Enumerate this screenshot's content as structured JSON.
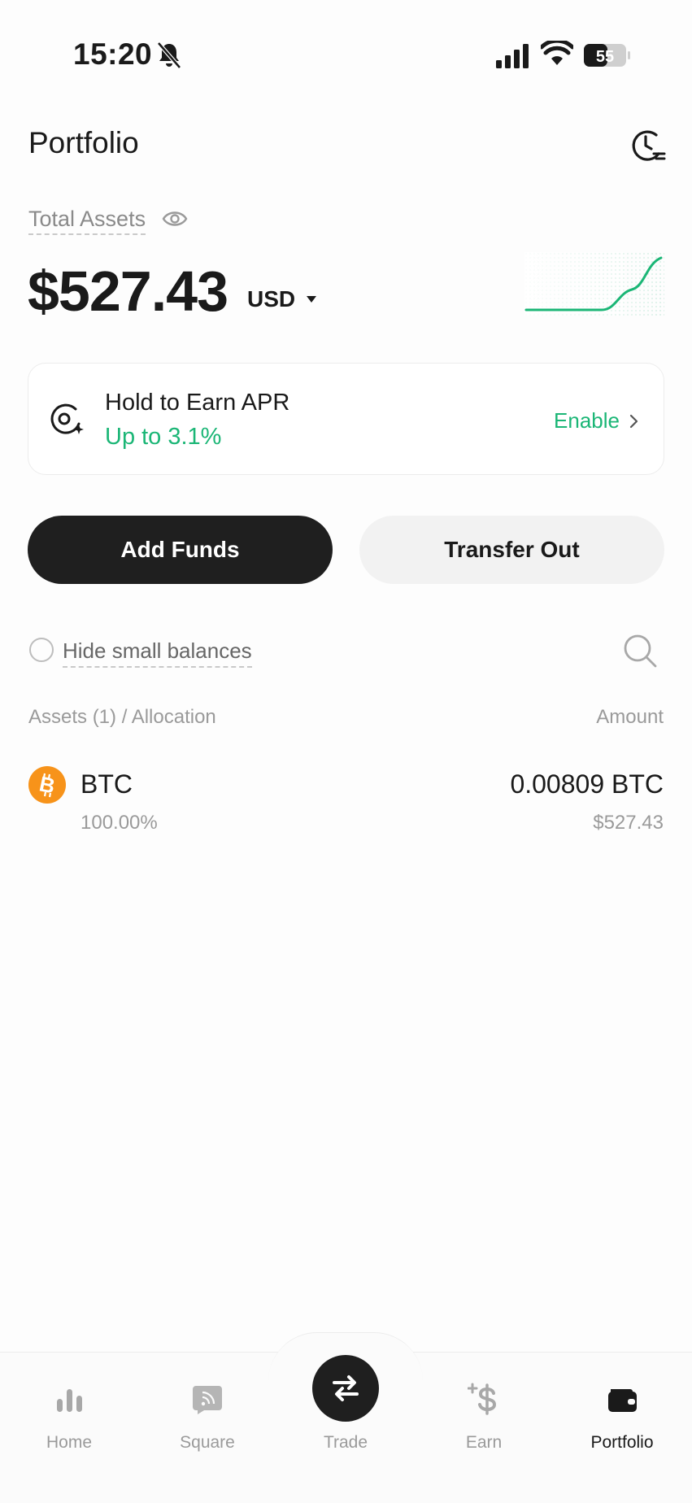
{
  "status_bar": {
    "time": "15:20",
    "battery_level": "55",
    "icons": [
      "bell-slash-icon",
      "signal-icon",
      "wifi-icon",
      "battery-icon"
    ]
  },
  "header": {
    "title": "Portfolio",
    "history_icon": "clock-history-icon"
  },
  "summary": {
    "label": "Total Assets",
    "value": "$527.43",
    "currency": "USD",
    "visibility_icon": "eye-icon",
    "trend_color": "#1bb676"
  },
  "earn_card": {
    "title": "Hold to Earn APR",
    "rate": "Up to 3.1%",
    "action": "Enable"
  },
  "actions": {
    "add_funds": "Add Funds",
    "transfer_out": "Transfer Out"
  },
  "filters": {
    "hide_small": "Hide small balances",
    "hide_small_checked": false
  },
  "assets_table": {
    "left_header": "Assets (1) / Allocation",
    "right_header": "Amount",
    "rows": [
      {
        "symbol": "BTC",
        "allocation": "100.00%",
        "amount": "0.00809 BTC",
        "value_usd": "$527.43",
        "icon": "bitcoin-icon",
        "icon_color": "#f7931a"
      }
    ]
  },
  "nav": {
    "items": [
      {
        "label": "Home",
        "icon": "bar-chart-icon"
      },
      {
        "label": "Square",
        "icon": "feed-icon"
      },
      {
        "label": "Trade",
        "icon": "swap-arrows-icon"
      },
      {
        "label": "Earn",
        "icon": "dollar-plus-icon"
      },
      {
        "label": "Portfolio",
        "icon": "wallet-icon",
        "active": true
      }
    ]
  },
  "colors": {
    "accent_green": "#1bb676",
    "primary_dark": "#1f1f1f"
  }
}
